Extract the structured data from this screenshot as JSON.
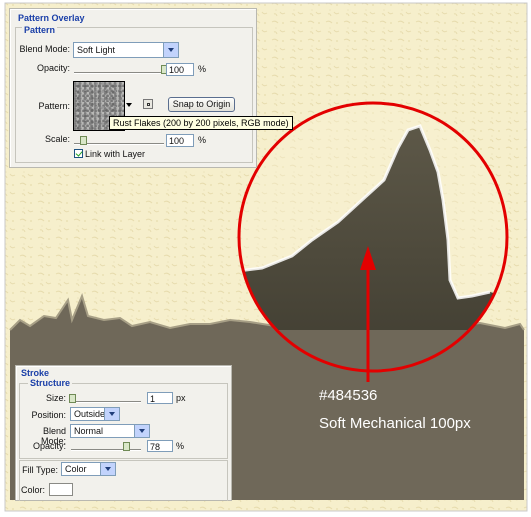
{
  "colors": {
    "parchment": "#f6efcc",
    "parchment_dark": "#efe4b7",
    "fill": "#6f6859",
    "callout_fill": "#484536",
    "callout_ring": "#e30000",
    "panel_title": "#1a3fa8"
  },
  "pattern_overlay": {
    "title": "Pattern Overlay",
    "group": "Pattern",
    "blend_mode_label": "Blend Mode:",
    "blend_mode_value": "Soft Light",
    "opacity_label": "Opacity:",
    "opacity_value": "100",
    "opacity_unit": "%",
    "opacity_level": 1.0,
    "pattern_label": "Pattern:",
    "pattern_icon": "new-preset-icon",
    "snap_button": "Snap to Origin",
    "tooltip": "Rust Flakes (200 by 200 pixels, RGB mode)",
    "scale_label": "Scale:",
    "scale_value": "100",
    "scale_unit": "%",
    "scale_level": 0.1,
    "link_label": "Link with Layer",
    "link_checked": true
  },
  "stroke": {
    "title": "Stroke",
    "group": "Structure",
    "size_label": "Size:",
    "size_value": "1",
    "size_unit": "px",
    "size_level": 0.01,
    "position_label": "Position:",
    "position_value": "Outside",
    "blend_label": "Blend Mode:",
    "blend_value": "Normal",
    "opacity_label": "Opacity:",
    "opacity_value": "78",
    "opacity_unit": "%",
    "opacity_level": 0.78,
    "fill_type_label": "Fill Type:",
    "fill_type_value": "Color",
    "color_label": "Color:",
    "color_value": "#ffffff"
  },
  "callout": {
    "hex": "#484536",
    "caption": "Soft Mechanical 100px"
  }
}
